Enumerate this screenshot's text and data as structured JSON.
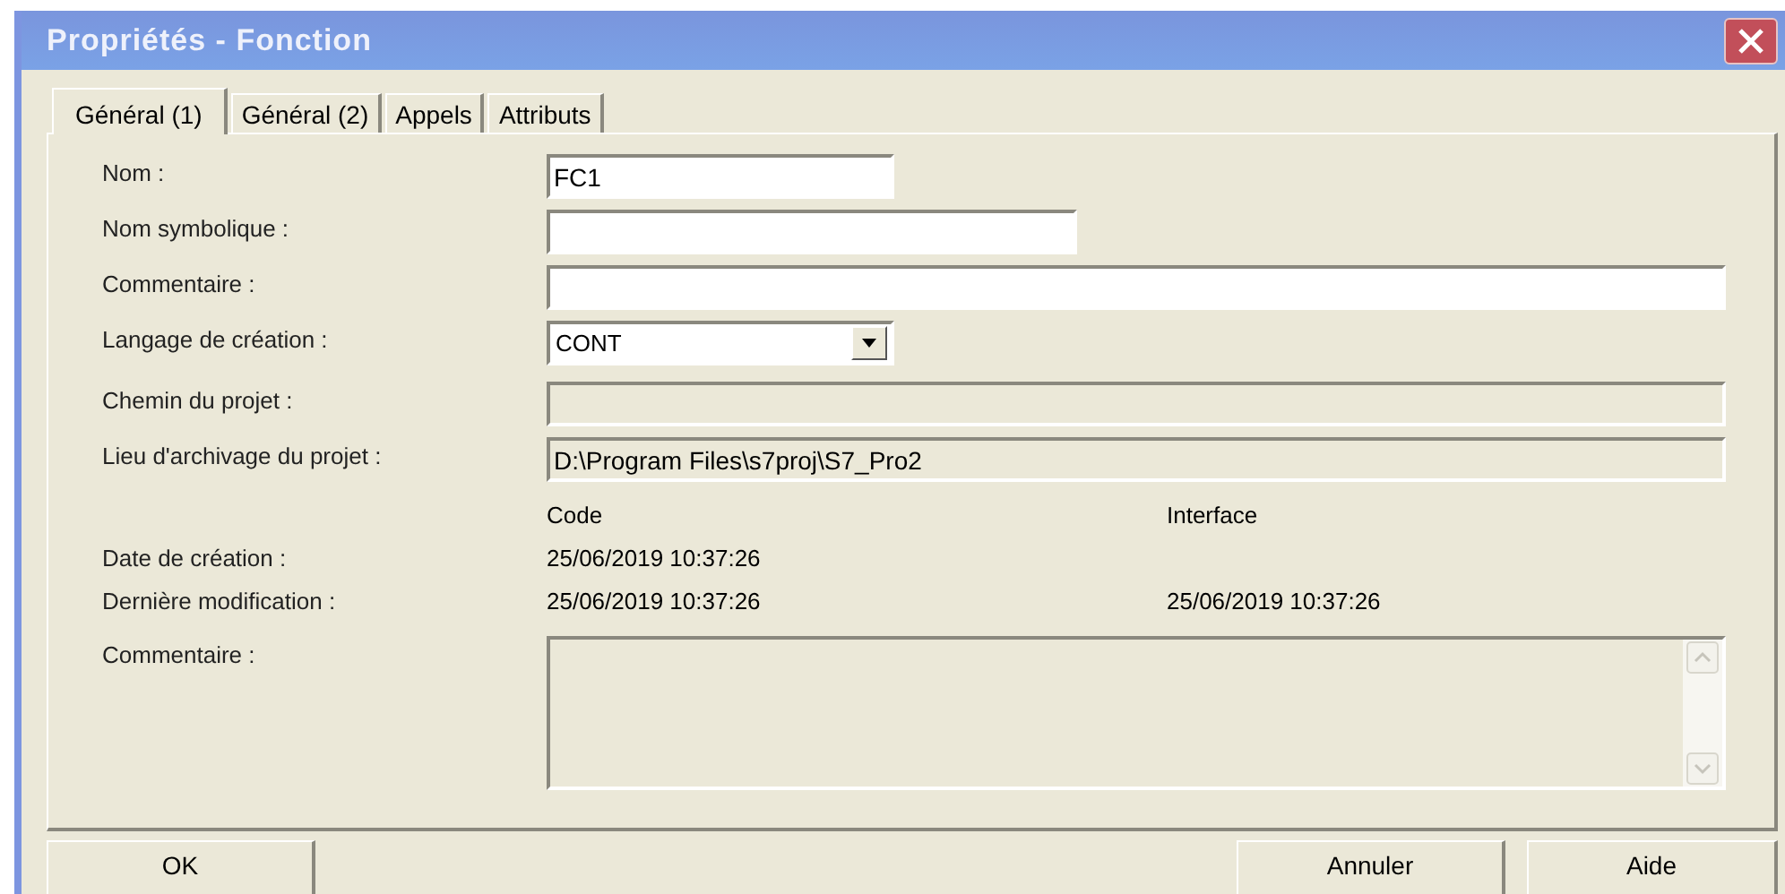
{
  "window": {
    "title": "Propriétés - Fonction"
  },
  "tabs": [
    {
      "label": "Général (1)",
      "selected": true
    },
    {
      "label": "Général  (2)",
      "selected": false
    },
    {
      "label": "Appels",
      "selected": false
    },
    {
      "label": "Attributs",
      "selected": false
    }
  ],
  "fields": [
    {
      "kind": "text",
      "label": "Nom :",
      "value": "FC1"
    },
    {
      "kind": "text",
      "label": "Nom symbolique :"
    },
    {
      "kind": "text",
      "label": "Commentaire :"
    },
    {
      "kind": "dropdown",
      "label": "Langage de création :",
      "value": "CONT"
    },
    {
      "kind": "readonly",
      "label": "Chemin du projet :"
    },
    {
      "kind": "readonly",
      "label": "Lieu  d'archivage du projet :",
      "value": "D:\\Program Files\\s7proj\\S7_Pro2"
    }
  ],
  "dates": {
    "columns": [
      "Code",
      "Interface"
    ],
    "rows": [
      {
        "label": "Date de création :",
        "code": "25/06/2019 10:37:26"
      },
      {
        "label": "Dernière modification :",
        "code": "25/06/2019 10:37:26",
        "interface": "25/06/2019 10:37:26"
      }
    ]
  },
  "comment_area": {
    "label": "Commentaire :"
  },
  "buttons": [
    {
      "label": "OK"
    },
    {
      "label": "Annuler"
    },
    {
      "label": "Aide"
    }
  ]
}
